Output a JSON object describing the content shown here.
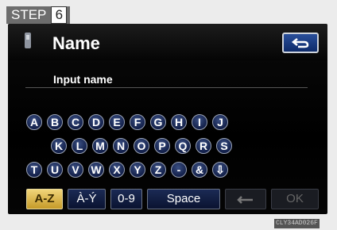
{
  "step": {
    "label": "STEP",
    "number": "6"
  },
  "header": {
    "title": "Name",
    "back_icon": "back-arrow-icon",
    "phone_icon": "phone-icon"
  },
  "input": {
    "label": "Input name"
  },
  "keyboard": {
    "row1": [
      "A",
      "B",
      "C",
      "D",
      "E",
      "F",
      "G",
      "H",
      "I",
      "J"
    ],
    "row2": [
      "K",
      "L",
      "M",
      "N",
      "O",
      "P",
      "Q",
      "R",
      "S"
    ],
    "row3": [
      "T",
      "U",
      "V",
      "W",
      "X",
      "Y",
      "Z",
      "-",
      "&",
      "⇩"
    ]
  },
  "bottom": {
    "az": "A-Z",
    "accents": "À-Ý",
    "digits": "0-9",
    "space": "Space",
    "backspace_icon": "backspace-arrow-icon",
    "ok": "OK"
  },
  "image_code": "CLY34AD026F"
}
